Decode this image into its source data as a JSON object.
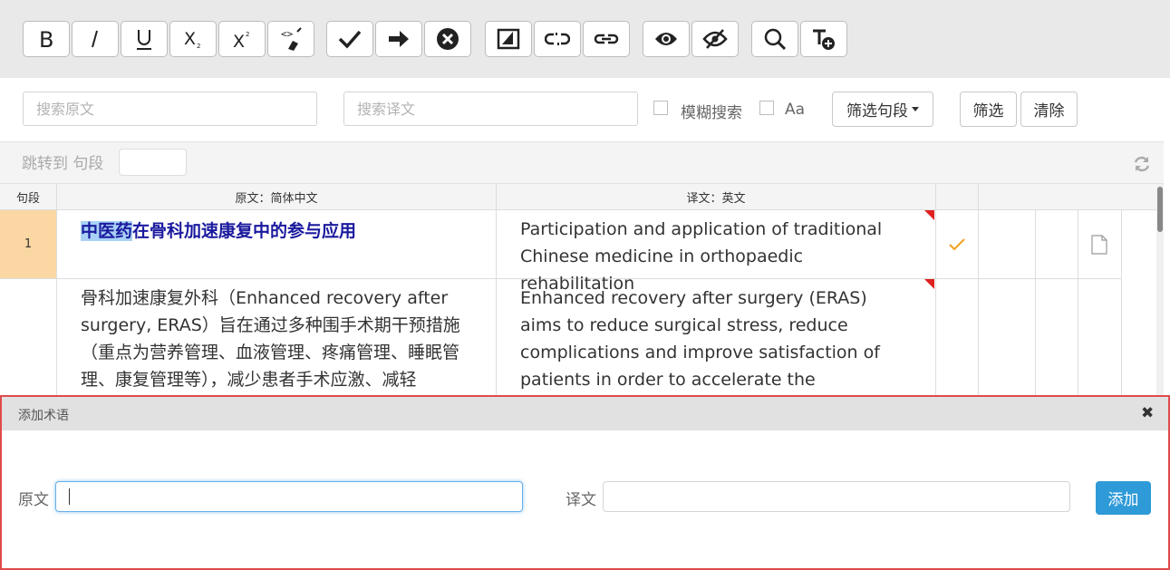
{
  "toolbar": {
    "buttons": [
      "bold-icon",
      "italic-icon",
      "underline-icon",
      "subscript-icon",
      "superscript-icon",
      "clear-format-icon",
      "check-icon",
      "arrow-right-icon",
      "cancel-circle-icon",
      "split-icon",
      "unlink-icon",
      "link-icon",
      "eye-icon",
      "eye-slash-icon",
      "search-icon",
      "add-text-icon"
    ]
  },
  "search": {
    "source_placeholder": "搜索原文",
    "target_placeholder": "搜索译文",
    "fuzzy_label": "模糊搜索",
    "case_label": "Aa",
    "filter_segments_label": "筛选句段",
    "filter_button": "筛选",
    "clear_button": "清除"
  },
  "jump": {
    "label": "跳转到 句段"
  },
  "table": {
    "headers": {
      "segment": "句段",
      "source": "原文：简体中文",
      "target": "译文：英文"
    },
    "rows": [
      {
        "num": "1",
        "source_highlight": "中医药",
        "source_rest": "在骨科加速康复中的参与应用",
        "target": "Participation and application of traditional Chinese medicine in orthopaedic rehabilitation",
        "status": "check-icon",
        "doc": "document-icon"
      },
      {
        "num": "",
        "source": "骨科加速康复外科（Enhanced recovery after surgery, ERAS）旨在通过多种围手术期干预措施（重点为营养管理、血液管理、疼痛管理、睡眠管理、康复管理等），减少患者手术应激、减轻",
        "target": "Enhanced recovery after surgery (ERAS) aims to reduce surgical stress, reduce complications and improve satisfaction of patients in order to accelerate the postoperative rehabilitation"
      }
    ]
  },
  "dialog": {
    "title": "添加术语",
    "source_label": "原文",
    "target_label": "译文",
    "source_value": "",
    "target_value": "",
    "add_button": "添加",
    "close_icon": "close-icon"
  },
  "colors": {
    "segment_active_bg": "#fbd7a3",
    "source_title": "#1a1a9e",
    "highlight": "#a8d1f5",
    "check": "#f0a020",
    "add_button": "#2e9ad8",
    "dialog_border": "#e04b4b",
    "error_corner": "#e02020"
  }
}
